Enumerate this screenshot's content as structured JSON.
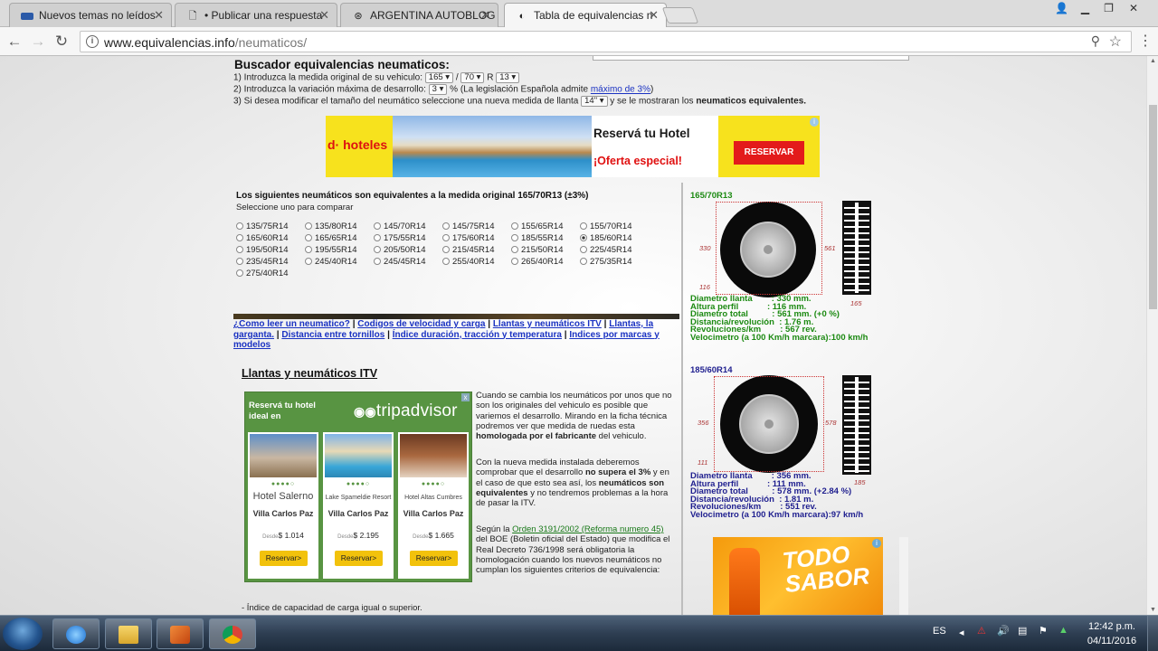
{
  "browser": {
    "tabs": [
      {
        "title": "Nuevos temas no leídos",
        "icon": "forum-icon"
      },
      {
        "title": "• Publicar una respuesta",
        "icon": "document-icon"
      },
      {
        "title": "ARGENTINA AUTOBLOG",
        "icon": "autoblog-icon"
      },
      {
        "title": "Tabla de equivalencias n",
        "icon": "site-icon"
      }
    ],
    "url_host": "www.equivalencias.info",
    "url_path": "/neumaticos/"
  },
  "finder": {
    "title": "Buscador equivalencias neumaticos:",
    "step1": "1) Introduzca la medida original de su vehiculo:",
    "width": "165",
    "profile": "70",
    "rim_prefix": "R",
    "rim": "13",
    "step2": "2) Introduzca la variación máxima de desarrollo:",
    "variation": "3",
    "step2_suffix": "% (La legislación Española admite",
    "max_link": "máximo de 3%",
    "step2_close": ")",
    "step3": "3) Si desea modificar el tamaño del neumático seleccione una nueva medida de llanta",
    "new_rim": "14\"",
    "step3_suffix": "y se le mostraran los",
    "step3_bold": "neumaticos equivalentes."
  },
  "banner_ad": {
    "logo": "d· hoteles",
    "title": "Reservá tu Hotel",
    "offer": "¡Oferta especial!",
    "button": "RESERVAR",
    "info": "i"
  },
  "results": {
    "title": "Los siguientes neumáticos son equivalentes a la medida original 165/70R13 (±3%)",
    "subtitle": "Seleccione uno para comparar",
    "options": [
      "135/75R14",
      "135/80R14",
      "145/70R14",
      "145/75R14",
      "155/65R14",
      "155/70R14",
      "165/60R14",
      "165/65R14",
      "175/55R14",
      "175/60R14",
      "185/55R14",
      "185/60R14",
      "195/50R14",
      "195/55R14",
      "205/50R14",
      "215/45R14",
      "215/50R14",
      "225/45R14",
      "235/45R14",
      "245/40R14",
      "245/45R14",
      "255/40R14",
      "265/40R14",
      "275/35R14",
      "275/40R14"
    ],
    "selected": "185/60R14"
  },
  "navlinks": {
    "l1": "¿Como leer un neumatico?",
    "l2": "Codigos de velocidad y carga",
    "l3": "Llantas y neumáticos ITV",
    "l4": "Llantas, la garganta.",
    "l5": "Distancia entre tornillos",
    "l6": "Índice duración, tracción y temperatura",
    "l7": "Indices por marcas y modelos",
    "sep": "|"
  },
  "article": {
    "title": "Llantas y neumáticos ITV",
    "p1": "Cuando se cambia los neumáticos por unos que no son los originales del vehiculo es posible que variemos el desarrollo. Mirando en la ficha técnica podremos ver que medida de ruedas esta",
    "p1_bold": "homologada por el fabricante",
    "p1_end": "del vehiculo.",
    "p2a": "Con la nueva medida instalada deberemos comprobar que el desarrollo",
    "p2_bold1": "no supera el 3%",
    "p2b": "y en el caso de que esto sea así, los",
    "p2_bold2": "neumáticos son equivalentes",
    "p2c": "y no tendremos problemas a la hora de pasar la ITV.",
    "p3a": "Según la",
    "p3_link": "Orden 3191/2002 (Reforma numero 45)",
    "p3b": "del BOE (Boletin oficial del Estado) que modifica el Real Decreto 736/1998 será obligatoria la homologación cuando los nuevos neumáticos no cumplan los siguientes criterios de equivalencia:",
    "bullet": "- Índice de capacidad de carga igual o superior."
  },
  "tripadvisor_ad": {
    "header": "Reservá tu hotel ideal en",
    "brand": "tripadvisor",
    "close": "x",
    "hotels": [
      {
        "name": "Hotel Salerno",
        "location": "Villa Carlos Paz",
        "from": "Desde",
        "price": "$ 1.014",
        "button": "Reservar>"
      },
      {
        "name": "Lake Spameldie Resort",
        "location": "Villa Carlos Paz",
        "from": "Desde",
        "price": "$ 2.195",
        "button": "Reservar>"
      },
      {
        "name": "Hotel Altas Cumbres",
        "location": "Villa Carlos Paz",
        "from": "Desde",
        "price": "$ 1.665",
        "button": "Reservar>"
      }
    ]
  },
  "compare": {
    "original": {
      "size": "165/70R13",
      "color": "#1c8a12",
      "dim_rim": "330",
      "dim_total": "561",
      "dim_profile": "116",
      "dim_width": "165",
      "lines": [
        "Diametro llanta        : 330 mm.",
        "Altura perfil            : 116 mm.",
        "Diametro total          : 561 mm. (+0 %)",
        "Distancia/revolución  : 1.76 m.",
        "Revoluciones/km        : 567 rev.",
        "Velocimetro (a 100 Km/h marcara):100 km/h"
      ]
    },
    "equivalent": {
      "size": "185/60R14",
      "color": "#1f1f8f",
      "dim_rim": "356",
      "dim_total": "578",
      "dim_profile": "111",
      "dim_width": "185",
      "lines": [
        "Diametro llanta        : 356 mm.",
        "Altura perfil            : 111 mm.",
        "Diametro total          : 578 mm. (+2.84 %)",
        "Distancia/revolución  : 1.81 m.",
        "Revoluciones/km        : 551 rev.",
        "Velocimetro (a 100 Km/h marcara):97 km/h"
      ]
    }
  },
  "side_ad": {
    "text": "TODO SABOR"
  },
  "taskbar": {
    "lang": "ES",
    "time": "12:42 p.m.",
    "date": "04/11/2016"
  }
}
